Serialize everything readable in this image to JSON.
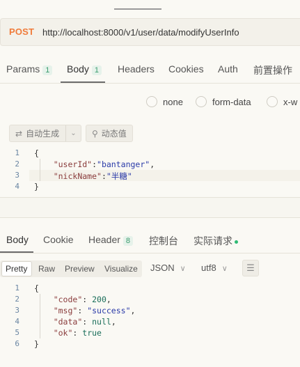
{
  "request": {
    "method": "POST",
    "url": "http://localhost:8000/v1/user/data/modifyUserInfo"
  },
  "request_tabs": [
    {
      "label": "Params",
      "badge": "1"
    },
    {
      "label": "Body",
      "badge": "1"
    },
    {
      "label": "Headers"
    },
    {
      "label": "Cookies"
    },
    {
      "label": "Auth"
    },
    {
      "label": "前置操作"
    }
  ],
  "body_types": [
    "none",
    "form-data",
    "x-w"
  ],
  "tools": {
    "auto_generate": "自动生成",
    "dynamic_value": "动态值"
  },
  "request_body_lines": [
    {
      "n": "1",
      "text": "{"
    },
    {
      "n": "2",
      "key": "\"userId\"",
      "val": "\"bantanger\"",
      "trail": ","
    },
    {
      "n": "3",
      "key": "\"nickName\"",
      "val": "\"半糖\"",
      "trail": ""
    },
    {
      "n": "4",
      "text": "}"
    }
  ],
  "response_tabs": [
    {
      "label": "Body"
    },
    {
      "label": "Cookie"
    },
    {
      "label": "Header",
      "badge": "8"
    },
    {
      "label": "控制台"
    },
    {
      "label": "实际请求"
    }
  ],
  "format_modes": [
    "Pretty",
    "Raw",
    "Preview",
    "Visualize"
  ],
  "format_select": "JSON",
  "encoding_select": "utf8",
  "response_body_lines": [
    {
      "n": "1",
      "text": "{"
    },
    {
      "n": "2",
      "key": "\"code\"",
      "val": "200",
      "type": "num",
      "trail": ","
    },
    {
      "n": "3",
      "key": "\"msg\"",
      "val": "\"success\"",
      "type": "str",
      "trail": ","
    },
    {
      "n": "4",
      "key": "\"data\"",
      "val": "null",
      "type": "num",
      "trail": ","
    },
    {
      "n": "5",
      "key": "\"ok\"",
      "val": "true",
      "type": "num",
      "trail": ""
    },
    {
      "n": "6",
      "text": "}"
    }
  ],
  "colors": {
    "method_post": "#f07b3a",
    "badge_green": "#3a9b6d",
    "status_dot": "#2fba74"
  }
}
